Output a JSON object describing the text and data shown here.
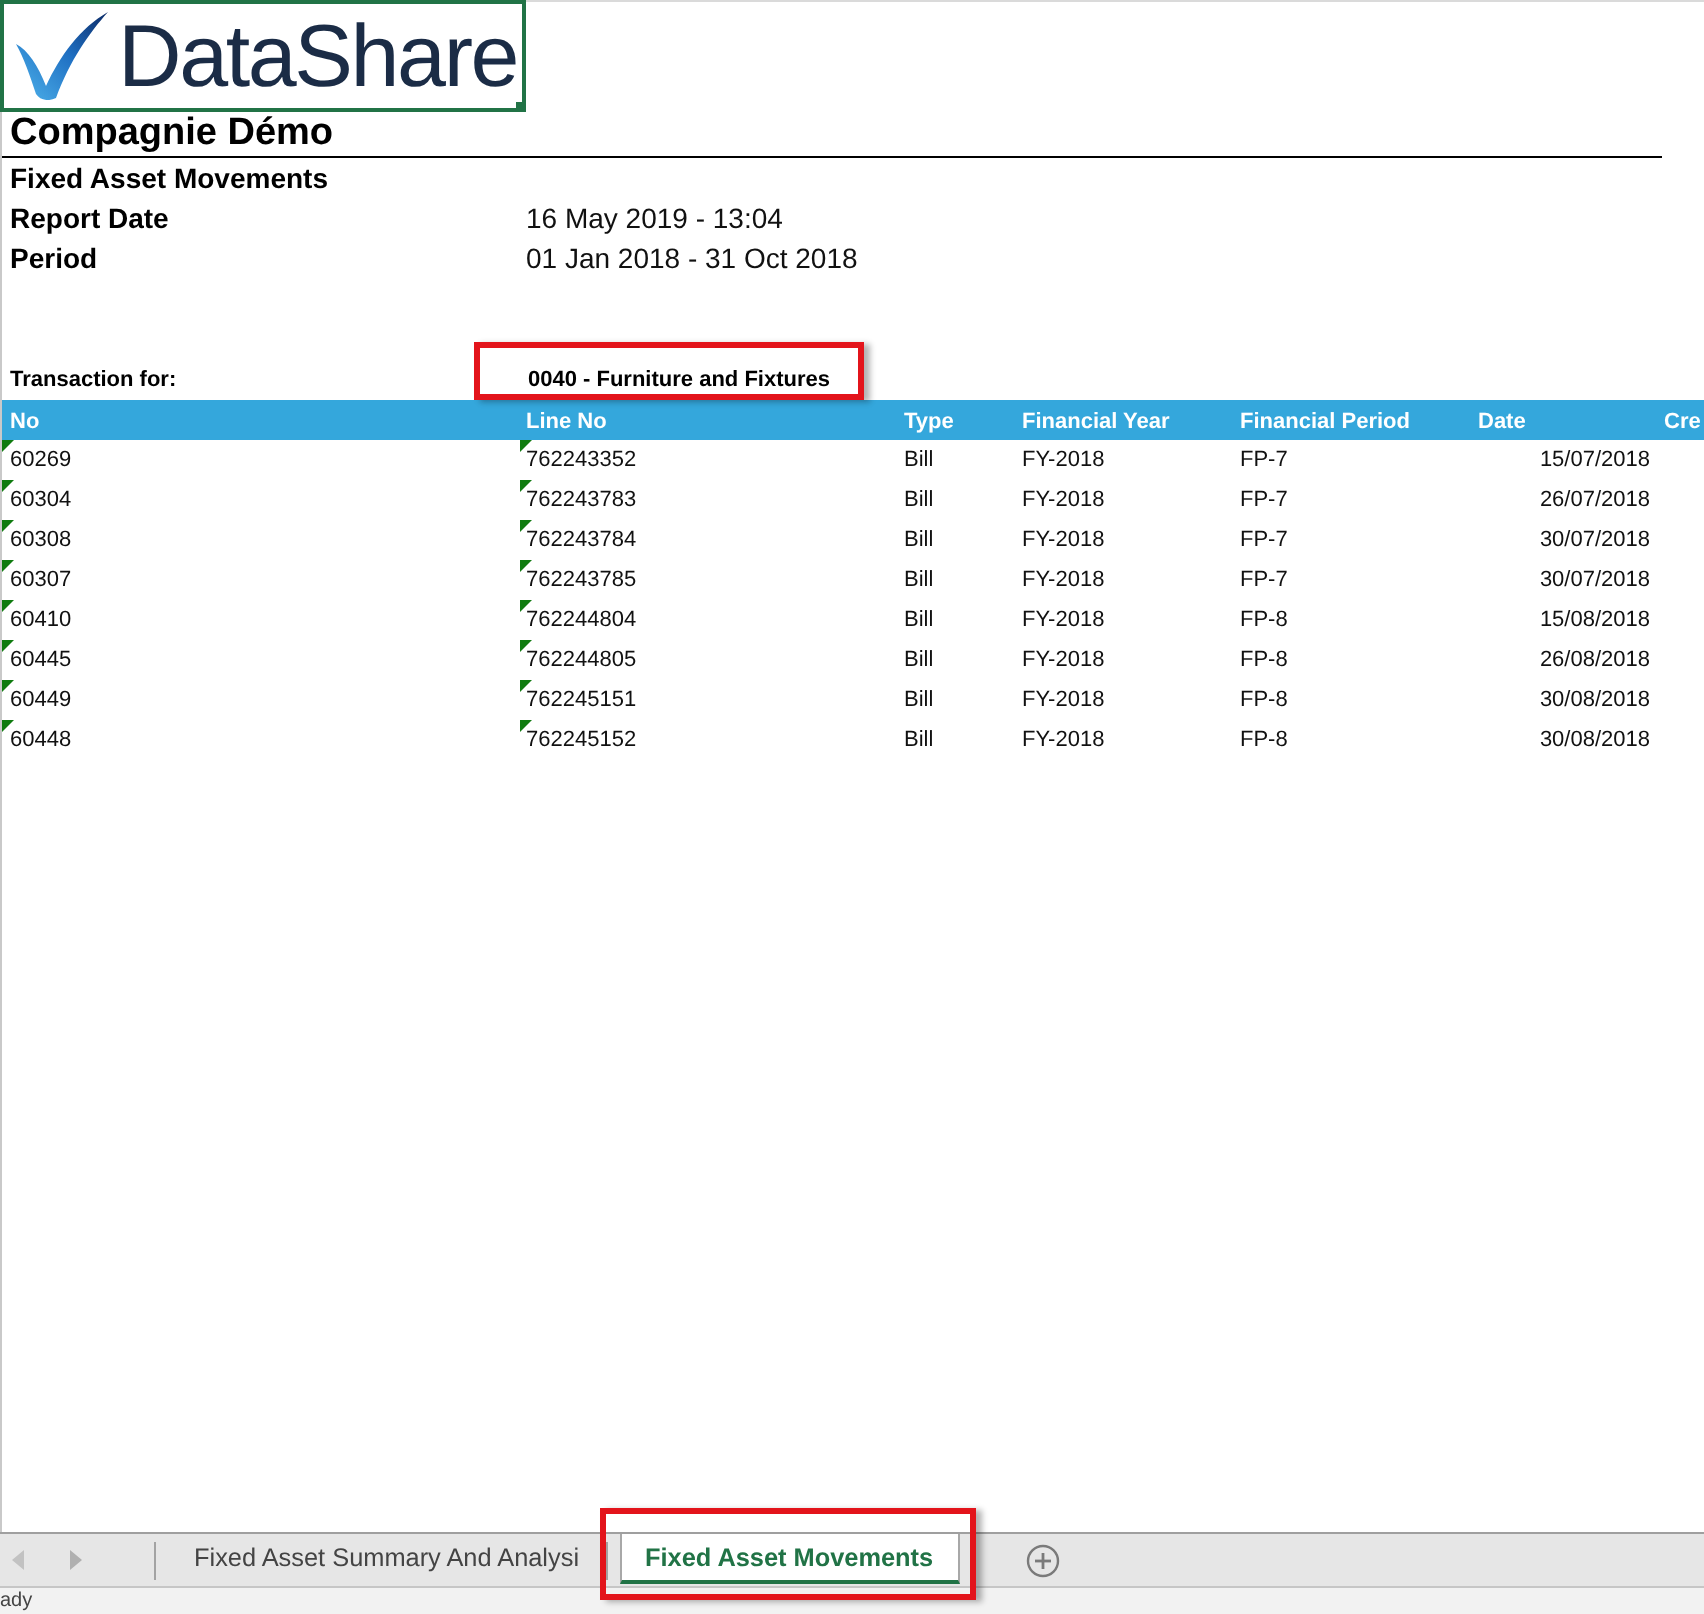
{
  "logo": {
    "text": "DataShare",
    "selected": true
  },
  "report": {
    "company": "Compagnie Démo",
    "title": "Fixed Asset Movements",
    "fields": [
      {
        "label": "Report Date",
        "value": "16 May 2019 - 13:04"
      },
      {
        "label": "Period",
        "value": "01 Jan 2018 - 31 Oct 2018"
      }
    ]
  },
  "transaction_for": {
    "label": "Transaction for:",
    "value": "0040 - Furniture and Fixtures",
    "highlighted": true
  },
  "table": {
    "columns": [
      "No",
      "Line No",
      "Type",
      "Financial Year",
      "Financial Period",
      "Date",
      "Cre"
    ],
    "rows": [
      {
        "cells": [
          "60269",
          "762243352",
          "Bill",
          "FY-2018",
          "FP-7",
          "15/07/2018"
        ],
        "flagged": true
      },
      {
        "cells": [
          "60304",
          "762243783",
          "Bill",
          "FY-2018",
          "FP-7",
          "26/07/2018"
        ],
        "flagged": true
      },
      {
        "cells": [
          "60308",
          "762243784",
          "Bill",
          "FY-2018",
          "FP-7",
          "30/07/2018"
        ],
        "flagged": true
      },
      {
        "cells": [
          "60307",
          "762243785",
          "Bill",
          "FY-2018",
          "FP-7",
          "30/07/2018"
        ],
        "flagged": true
      },
      {
        "cells": [
          "60410",
          "762244804",
          "Bill",
          "FY-2018",
          "FP-8",
          "15/08/2018"
        ],
        "flagged": true
      },
      {
        "cells": [
          "60445",
          "762244805",
          "Bill",
          "FY-2018",
          "FP-8",
          "26/08/2018"
        ],
        "flagged": true
      },
      {
        "cells": [
          "60449",
          "762245151",
          "Bill",
          "FY-2018",
          "FP-8",
          "30/08/2018"
        ],
        "flagged": true
      },
      {
        "cells": [
          "60448",
          "762245152",
          "Bill",
          "FY-2018",
          "FP-8",
          "30/08/2018"
        ],
        "flagged": true
      }
    ]
  },
  "sheet_tabs": [
    {
      "label": "Fixed Asset Summary And Analysi",
      "selected": false,
      "highlighted": false
    },
    {
      "label": "Fixed Asset Movements",
      "selected": true,
      "highlighted": true
    }
  ],
  "status_bar": {
    "text": "ady"
  }
}
